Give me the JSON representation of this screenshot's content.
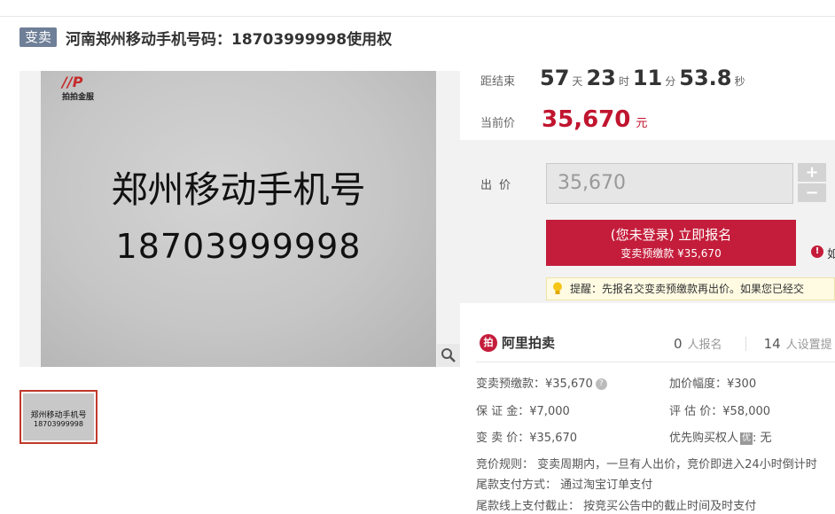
{
  "header": {
    "tag": "变卖",
    "title": "河南郑州移动手机号码：18703999998使用权"
  },
  "image": {
    "logo_mark": "//P",
    "logo_name": "拍拍金服",
    "line1": "郑州移动手机号",
    "line2": "18703999998",
    "thumb_line1": "郑州移动手机号",
    "thumb_line2": "18703999998"
  },
  "countdown": {
    "label": "距结束",
    "days": "57",
    "days_unit": "天",
    "hours": "23",
    "hours_unit": "时",
    "minutes": "11",
    "minutes_unit": "分",
    "seconds": "53.8",
    "seconds_unit": "秒"
  },
  "current_price": {
    "label": "当前价",
    "value": "35,670",
    "unit": "元"
  },
  "bid": {
    "label": "出价",
    "value": "35,670",
    "plus": "+",
    "minus": "−",
    "button_line1": "(您未登录) 立即报名",
    "button_line2": "变卖预缴款 ¥35,670",
    "side_note": "如",
    "tip": "提醒：先报名交变卖预缴款再出价。如果您已经交"
  },
  "platform": {
    "logo_mark": "拍",
    "name": "阿里拍卖",
    "signups_num": "0",
    "signups_text": "人报名",
    "reminders_num": "14",
    "reminders_text": "人设置提"
  },
  "details": {
    "deposit": "变卖预缴款：¥35,670",
    "increment": "加价幅度：¥300",
    "guarantee": "保 证 金：¥7,000",
    "appraisal": "评 估 价：¥58,000",
    "sale_price": "变 卖 价：¥35,670",
    "priority_label": "优先购买权人",
    "priority_badge": "优",
    "priority_value": ": 无",
    "rule_label": "竞价规则：",
    "rule_value": "变卖周期内，一旦有人出价，竞价即进入24小时倒计时",
    "payment_label": "尾款支付方式：",
    "payment_value": "通过淘宝订单支付",
    "deadline_label": "尾款线上支付截止：",
    "deadline_value": "按竞买公告中的截止时间及时支付"
  },
  "colors": {
    "accent": "#c41d3b",
    "tag": "#6e7f97"
  },
  "icons": [
    "zoom-icon",
    "info-icon",
    "bulb-icon",
    "help-icon"
  ]
}
